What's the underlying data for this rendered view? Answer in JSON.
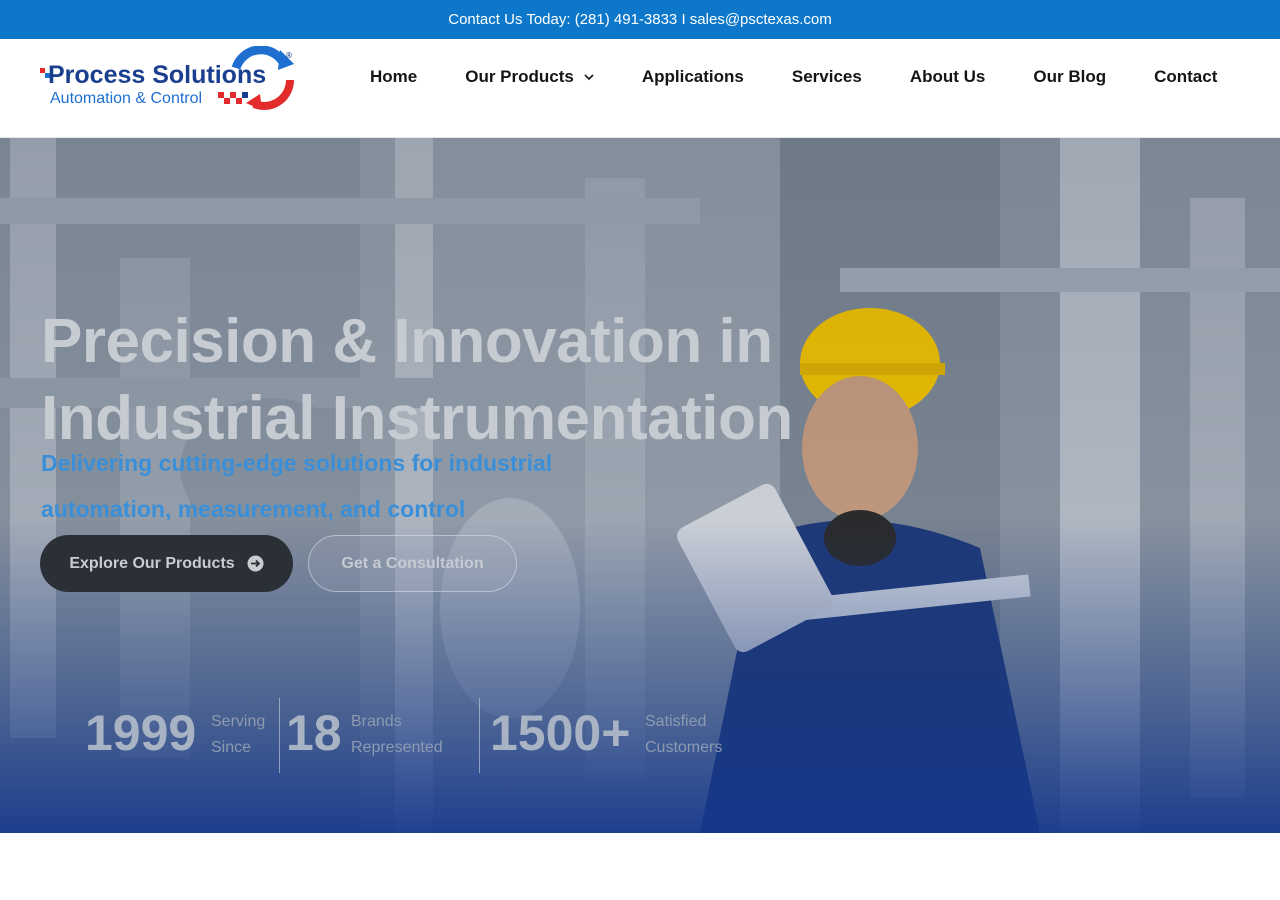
{
  "topbar": {
    "prefix": "Contact Us Today: ",
    "phone": "(281) 491-3833",
    "separator": " I ",
    "email": "sales@psctexas.com"
  },
  "logo": {
    "brand": "Process Solutions",
    "tagline": "Automation & Control",
    "registered": "®"
  },
  "nav": {
    "home": "Home",
    "products": "Our Products",
    "applications": "Applications",
    "services": "Services",
    "about": "About Us",
    "blog": "Our Blog",
    "contact": "Contact"
  },
  "hero": {
    "title_line1": "Precision & Innovation in",
    "title_line2": "Industrial Instrumentation",
    "subtitle": "Delivering cutting-edge solutions for industrial automation, measurement, and control",
    "primary_button": "Explore Our Products",
    "secondary_button": "Get a Consultation"
  },
  "stats": [
    {
      "value": "1999",
      "label_line1": "Serving",
      "label_line2": "Since"
    },
    {
      "value": "18",
      "label_line1": "Brands",
      "label_line2": "Represented"
    },
    {
      "value": "1500+",
      "label_line1": "Satisfied",
      "label_line2": "Customers"
    }
  ],
  "colors": {
    "topbar": "#0d78c9",
    "accent_blue": "#3a8fd8",
    "logo_navy": "#1b3f8f",
    "logo_red": "#e42b2b"
  }
}
